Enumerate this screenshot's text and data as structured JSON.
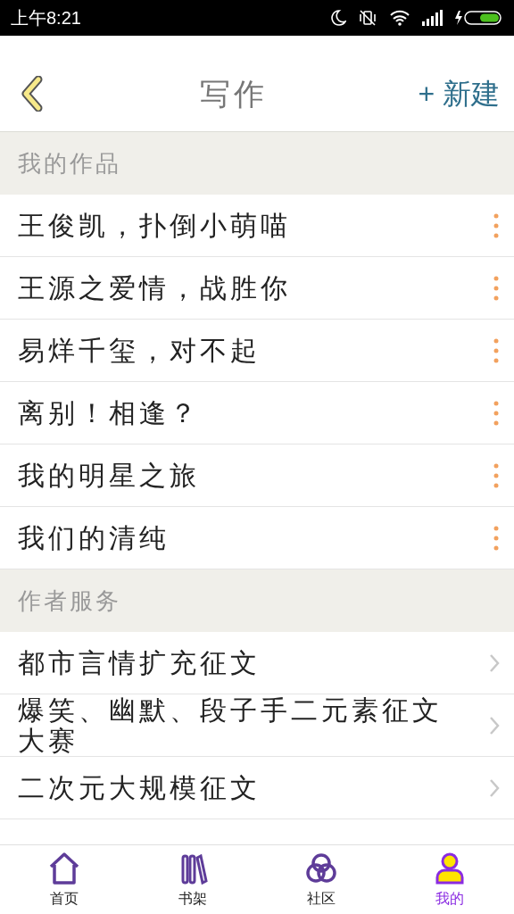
{
  "status_bar": {
    "time": "上午8:21"
  },
  "header": {
    "title": "写作",
    "action": "+ 新建"
  },
  "sections": [
    {
      "title": "我的作品",
      "kind": "works",
      "items": [
        {
          "label": "王俊凯，扑倒小萌喵"
        },
        {
          "label": "王源之爱情，战胜你"
        },
        {
          "label": "易烊千玺，对不起"
        },
        {
          "label": "离别！相逢？"
        },
        {
          "label": "我的明星之旅"
        },
        {
          "label": "我们的清纯"
        }
      ]
    },
    {
      "title": "作者服务",
      "kind": "services",
      "items": [
        {
          "label": "都市言情扩充征文"
        },
        {
          "label": "爆笑、幽默、段子手二元素征文大赛"
        },
        {
          "label": "二次元大规模征文"
        }
      ]
    }
  ],
  "tabs": [
    {
      "label": "首页",
      "kind": "home",
      "selected": false
    },
    {
      "label": "书架",
      "kind": "shelf",
      "selected": false
    },
    {
      "label": "社区",
      "kind": "community",
      "selected": false
    },
    {
      "label": "我的",
      "kind": "me",
      "selected": true
    }
  ]
}
